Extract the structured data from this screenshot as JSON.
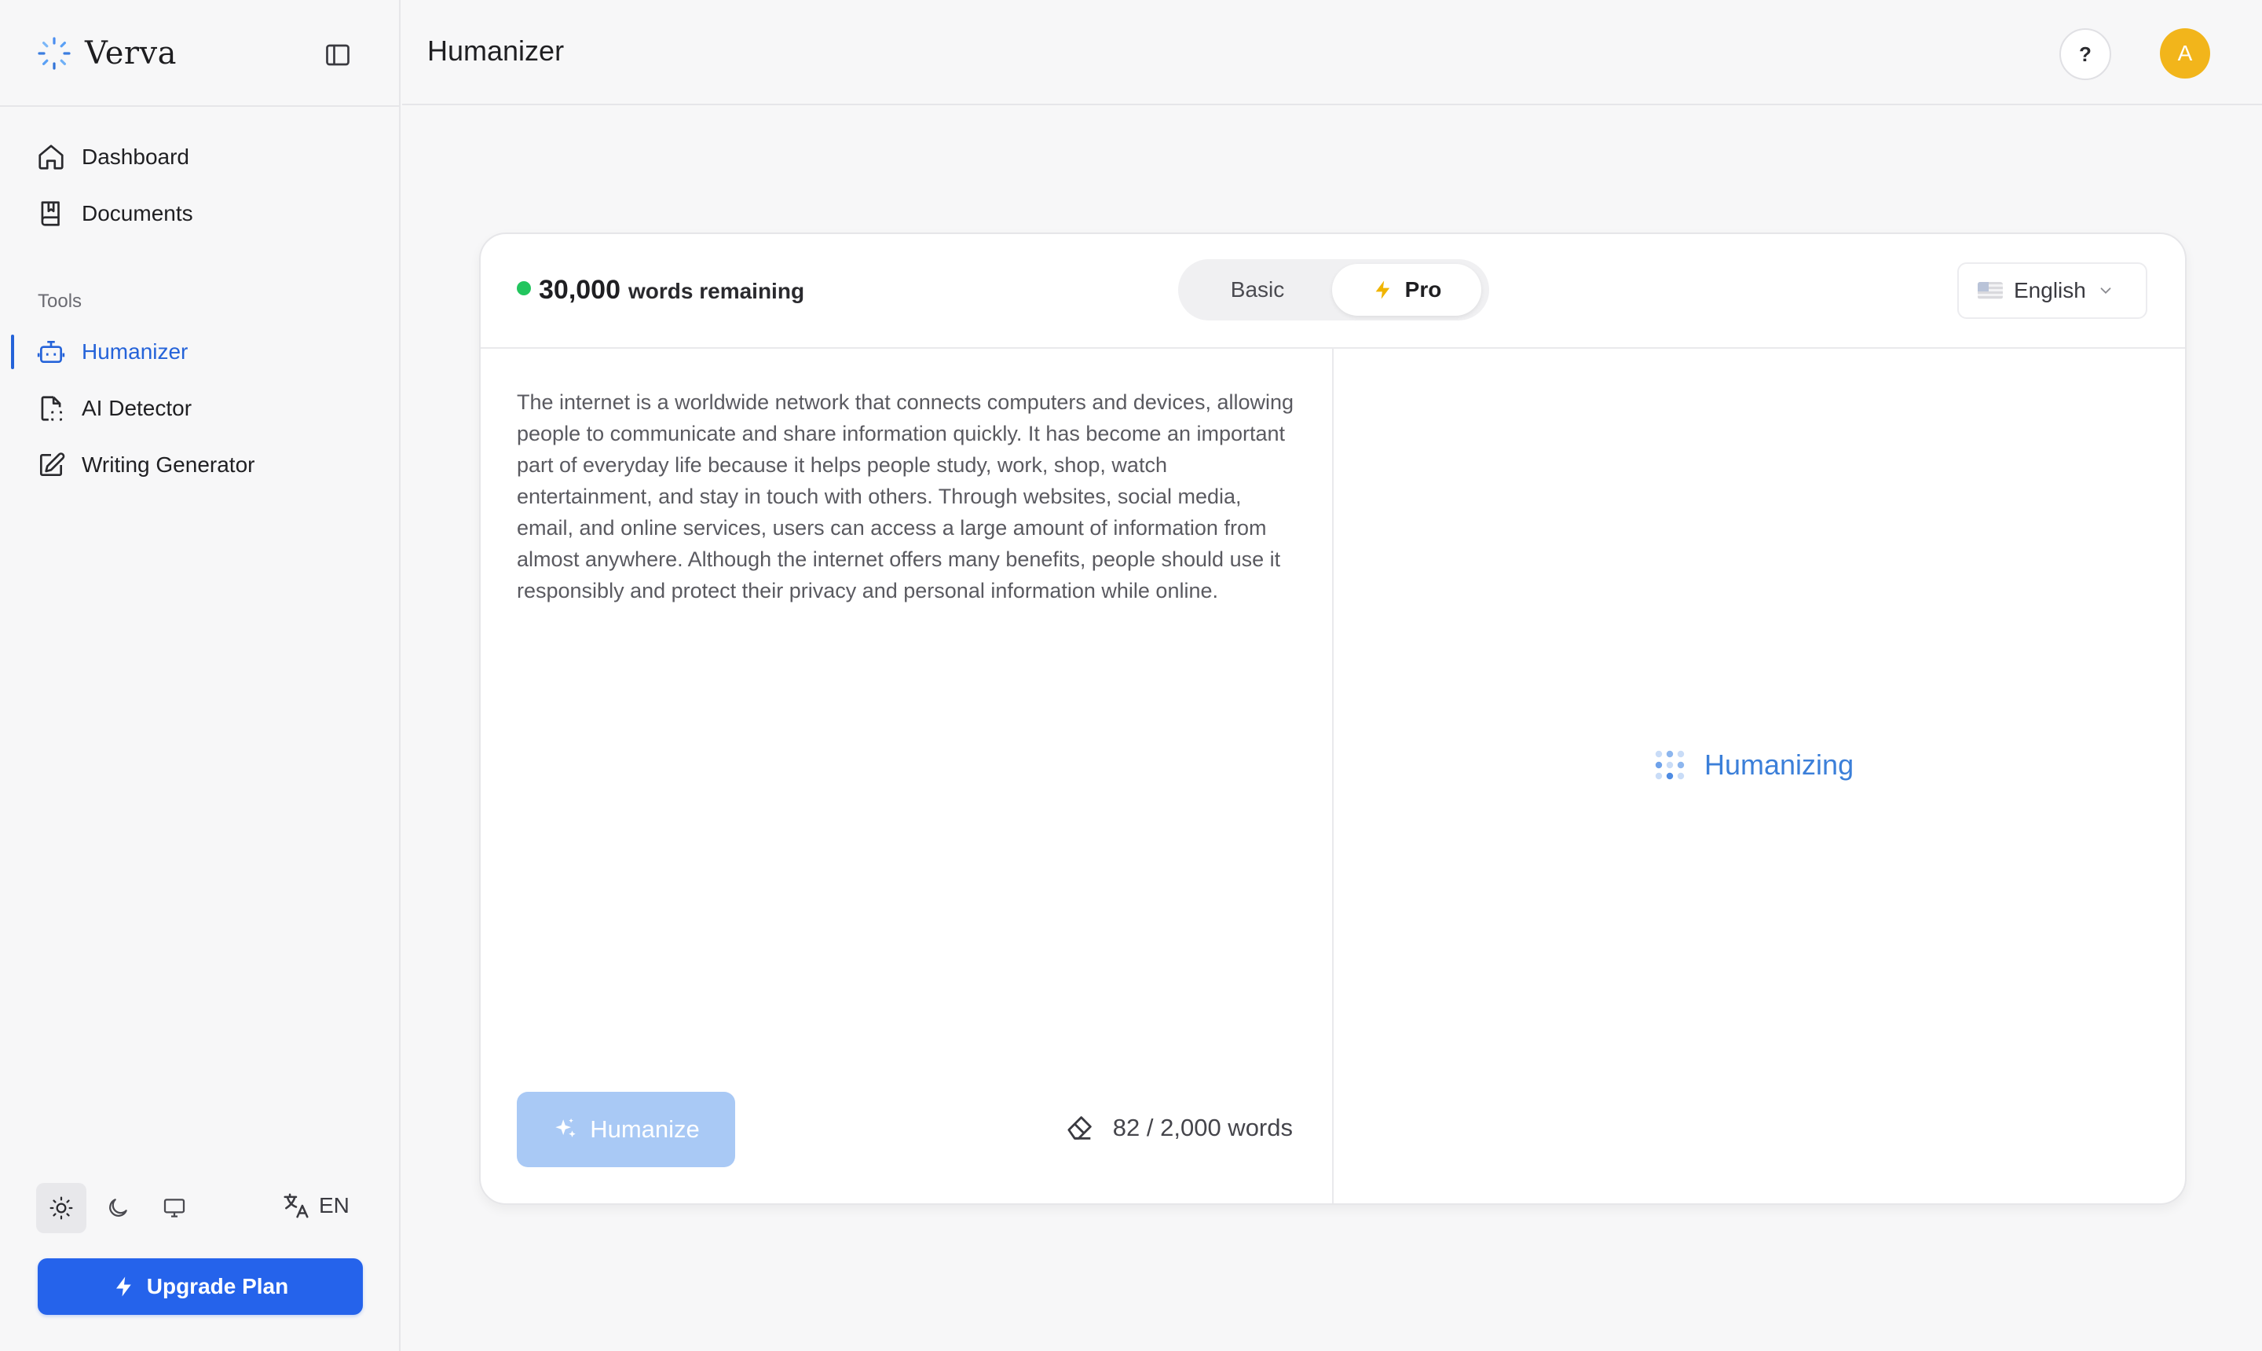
{
  "app": {
    "name": "Verva"
  },
  "header": {
    "title": "Humanizer",
    "help_label": "?",
    "avatar_initial": "A"
  },
  "sidebar": {
    "nav": [
      {
        "label": "Dashboard",
        "icon": "home-icon"
      },
      {
        "label": "Documents",
        "icon": "book-icon"
      }
    ],
    "section_label": "Tools",
    "tools": [
      {
        "label": "Humanizer",
        "icon": "robot-icon",
        "active": true
      },
      {
        "label": "AI Detector",
        "icon": "file-scan-icon"
      },
      {
        "label": "Writing Generator",
        "icon": "edit-icon"
      }
    ],
    "theme_options": [
      "light",
      "dark",
      "system"
    ],
    "theme_selected": "light",
    "language_code": "EN",
    "upgrade_label": "Upgrade Plan"
  },
  "card": {
    "words_remaining_count": "30,000",
    "words_remaining_label": "words remaining",
    "modes": [
      "Basic",
      "Pro"
    ],
    "selected_mode": "Pro",
    "output_language": "English",
    "input_text": "The internet is a worldwide network that connects computers and devices, allowing people to communicate and share information quickly. It has become an important part of everyday life because it helps people study, work, shop, watch entertainment, and stay in touch with others. Through websites, social media, email, and online services, users can access a large amount of information from almost anywhere. Although the internet offers many benefits, people should use it responsibly and protect their privacy and personal information while online.",
    "humanize_label": "Humanize",
    "word_count": "82 / 2,000 words",
    "status_text": "Humanizing"
  },
  "colors": {
    "accent": "#2563eb",
    "status_dot": "#22c55e",
    "avatar": "#f2b51b",
    "humanize_disabled": "#a9c9f5",
    "pro_bolt": "#f0b400"
  }
}
